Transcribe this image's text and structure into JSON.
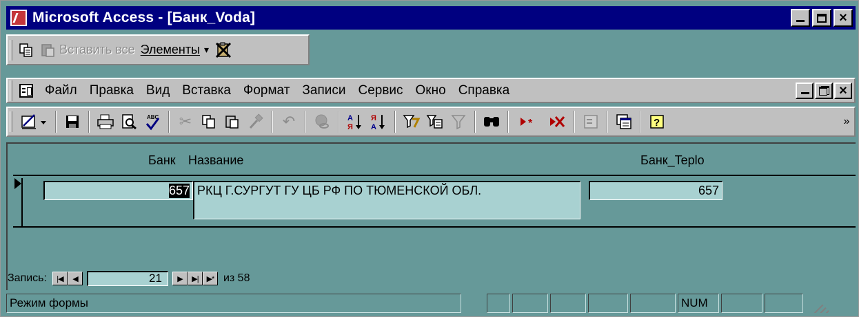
{
  "window": {
    "title": "Microsoft Access - [Банк_Voda]",
    "minimize_icon": "minimize-icon",
    "maximize_icon": "maximize-icon",
    "close_icon": "close-icon"
  },
  "clipboard_toolbar": {
    "copy_icon": "copy-icon",
    "paste_all_icon": "paste-all-icon",
    "paste_all_label": "Вставить все",
    "items_label": "Элементы",
    "dropdown_arrow": "▾",
    "clear_clipboard_icon": "clear-clipboard-icon"
  },
  "menu": {
    "items": [
      "Файл",
      "Правка",
      "Вид",
      "Вставка",
      "Формат",
      "Записи",
      "Сервис",
      "Окно",
      "Справка"
    ]
  },
  "toolbar": {
    "buttons": [
      "design-view-icon",
      "save-icon",
      "print-icon",
      "print-preview-icon",
      "spelling-icon",
      "cut-icon",
      "copy-icon",
      "paste-icon",
      "format-painter-icon",
      "undo-icon",
      "insert-hyperlink-icon",
      "sort-ascending-icon",
      "sort-descending-icon",
      "filter-by-selection-icon",
      "filter-by-form-icon",
      "apply-filter-icon",
      "find-icon",
      "new-record-icon",
      "delete-record-icon",
      "properties-icon",
      "database-window-icon",
      "help-icon",
      "toolbar-options-icon"
    ]
  },
  "form": {
    "header_left": "Банк",
    "header_name": "Название",
    "header_right": "Банк_Teplo",
    "bank_code": "657",
    "bank_name": "РКЦ Г.СУРГУТ ГУ ЦБ РФ ПО ТЮМЕНСКОЙ ОБЛ.",
    "bank_teplo": "657"
  },
  "navigation": {
    "label": "Запись:",
    "first": "|◀",
    "prev": "◀",
    "current": "21",
    "next": "▶",
    "last": "▶|",
    "new": "▶*",
    "of_label": "из 58"
  },
  "statusbar": {
    "mode": "Режим формы",
    "num": "NUM"
  }
}
